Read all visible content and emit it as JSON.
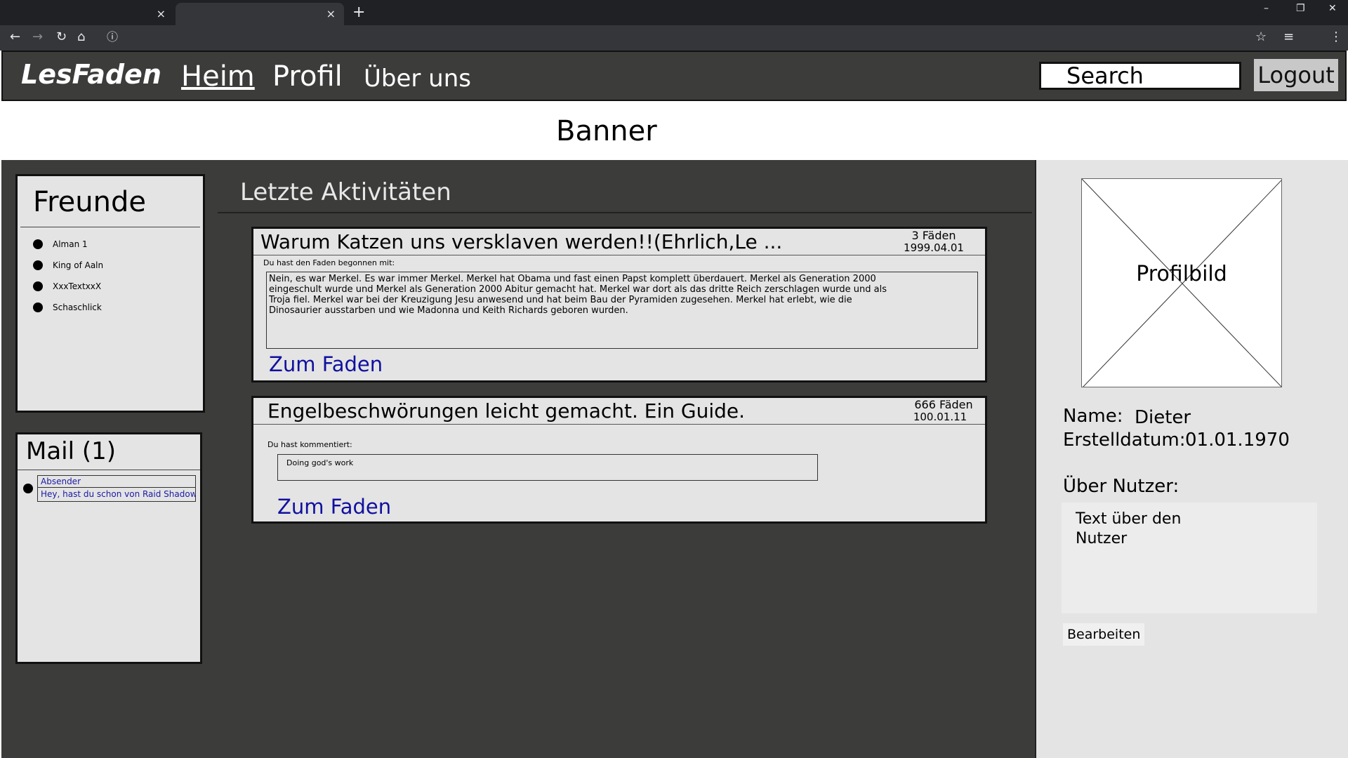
{
  "browser": {
    "tab_close": "×",
    "new_tab": "+",
    "minimize": "–",
    "restore": "❐",
    "close_window": "✕",
    "back": "←",
    "forward": "→",
    "reload": "↻",
    "home": "⌂",
    "info": "ⓘ",
    "bookmark": "☆",
    "playlist": "≡",
    "menu": "⋮"
  },
  "header": {
    "logo": "LesFaden",
    "nav": [
      "Heim",
      "Profil",
      "Über uns"
    ],
    "search_placeholder": "Search",
    "logout": "Logout"
  },
  "banner": "Banner",
  "friends": {
    "title": "Freunde",
    "items": [
      "Alman 1",
      "King of Aaln",
      "XxxTextxxX",
      "Schaschlick"
    ]
  },
  "mail": {
    "title": "Mail (1)",
    "sender": "Absender",
    "preview": "Hey, hast du schon von Raid Shadow..."
  },
  "activities": {
    "title": "Letzte Aktivitäten",
    "cards": [
      {
        "title": "Warum Katzen uns versklaven werden!!(Ehrlich,Le ...",
        "count": "3 Fäden",
        "date": "1999.04.01",
        "subtitle": "Du hast den Faden begonnen mit:",
        "text_lines": [
          "Nein, es war Merkel. Es war immer Merkel. Merkel hat Obama und fast einen Papst komplett überdauert. Merkel als Generation 2000",
          "eingeschult wurde und Merkel als Generation 2000 Abitur gemacht hat. Merkel war dort als das dritte Reich zerschlagen wurde und als",
          "Troja fiel. Merkel war bei der Kreuzigung Jesu anwesend und hat beim Bau der Pyramiden zugesehen. Merkel hat erlebt, wie die",
          "Dinosaurier ausstarben und wie Madonna und Keith Richards geboren wurden."
        ],
        "link": "Zum Faden"
      },
      {
        "title": "Engelbeschwörungen leicht gemacht. Ein Guide.",
        "count": "666 Fäden",
        "date": "100.01.11",
        "subtitle": "Du hast kommentiert:",
        "text_lines": [
          "Doing god's work"
        ],
        "link": "Zum Faden"
      }
    ]
  },
  "profile": {
    "image_label": "Profilbild",
    "name_label": "Name:",
    "name_value": "Dieter",
    "created_label": "Erstelldatum:",
    "created_value": "01.01.1970",
    "about_label": "Über Nutzer:",
    "about_text": "Text über den Nutzer",
    "edit": "Bearbeiten"
  }
}
